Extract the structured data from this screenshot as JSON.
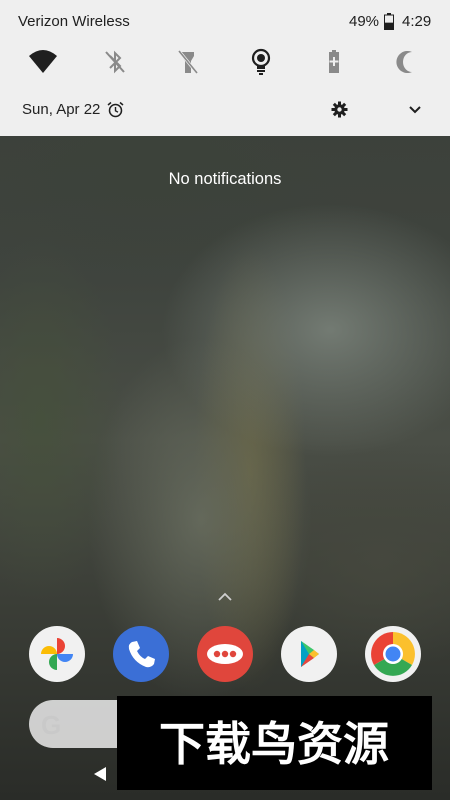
{
  "status_bar": {
    "carrier": "Verizon Wireless",
    "battery_percent": "49%",
    "battery_level": 0.49,
    "time": "4:29"
  },
  "quick_settings": {
    "tiles": [
      {
        "icon": "wifi-icon",
        "state": "on"
      },
      {
        "icon": "bluetooth-off-icon",
        "state": "off"
      },
      {
        "icon": "flashlight-off-icon",
        "state": "off"
      },
      {
        "icon": "lightbulb-icon",
        "state": "on"
      },
      {
        "icon": "battery-saver-icon",
        "state": "off"
      },
      {
        "icon": "do-not-disturb-moon-icon",
        "state": "off"
      }
    ],
    "date": "Sun, Apr 22",
    "alarm_icon": "alarm-clock-icon",
    "settings_icon": "gear-icon",
    "expand_icon": "chevron-down-icon"
  },
  "notifications": {
    "empty_message": "No notifications"
  },
  "home": {
    "dock_apps": [
      {
        "icon": "google-photos-icon"
      },
      {
        "icon": "phone-icon"
      },
      {
        "icon": "messages-icon"
      },
      {
        "icon": "play-store-icon"
      },
      {
        "icon": "chrome-icon"
      }
    ],
    "search_logo": "G",
    "search_icon": "google-search-icon"
  },
  "navigation": {
    "back_icon": "back-triangle-icon"
  },
  "watermark": {
    "text": "下载鸟资源"
  },
  "colors": {
    "panel_bg": "#efefef",
    "icon_dark": "#1f1f1f",
    "icon_disabled": "#8a8a8a",
    "text_white": "#ffffff",
    "phone_blue": "#3b6fd6",
    "messages_red": "#e0463c"
  }
}
